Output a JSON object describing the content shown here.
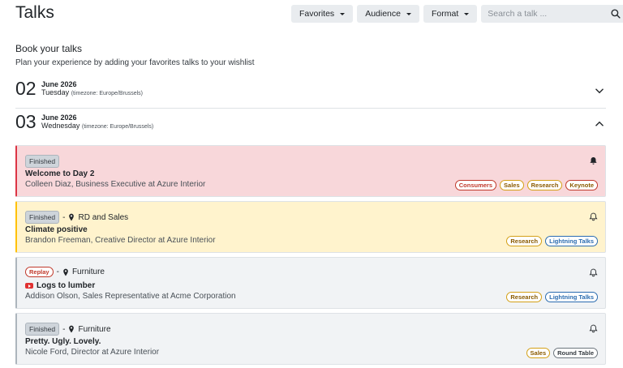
{
  "header": {
    "title": "Talks"
  },
  "toolbar": {
    "favorites_label": "Favorites",
    "audience_label": "Audience",
    "format_label": "Format",
    "search_placeholder": "Search a talk ..."
  },
  "intro": {
    "title": "Book your talks",
    "subtitle": "Plan your experience by adding your favorites talks to your wishlist"
  },
  "days": [
    {
      "num": "02",
      "month": "June 2026",
      "weekday": "Tuesday",
      "timezone": "(timezone: Europe/Brussels)",
      "chevron": "chevron-down-icon"
    },
    {
      "num": "03",
      "month": "June 2026",
      "weekday": "Wednesday",
      "timezone": "(timezone: Europe/Brussels)",
      "chevron": "chevron-up-icon"
    }
  ],
  "talks": [
    {
      "status": "Finished",
      "location": "",
      "title": "Welcome to Day 2",
      "speaker": "Colleen Diaz, Business Executive at Azure Interior",
      "bell": "bell-filled-icon",
      "accent": "#dc3545",
      "bg": "#f8d7da",
      "tags": [
        "Consumers",
        "Sales",
        "Research",
        "Keynote"
      ]
    },
    {
      "status": "Finished",
      "location": "RD and Sales",
      "title": "Climate positive",
      "speaker": "Brandon Freeman, Creative Director at Azure Interior",
      "bell": "bell-outline-icon",
      "accent": "#ffc107",
      "bg": "#fff3cd",
      "tags": [
        "Research",
        "Lightning Talks"
      ]
    },
    {
      "status": "Replay",
      "location": "Furniture",
      "title": "Logs to lumber",
      "speaker": "Addison Olson, Sales Representative at Acme Corporation",
      "bell": "bell-outline-icon",
      "accent": "#adb5bd",
      "bg": "#f1f3f5",
      "tags": [
        "Research",
        "Lightning Talks"
      ]
    },
    {
      "status": "Finished",
      "location": "Furniture",
      "title": "Pretty. Ugly. Lovely.",
      "speaker": "Nicole Ford, Director at Azure Interior",
      "bell": "bell-outline-icon",
      "accent": "#adb5bd",
      "bg": "#f1f3f5",
      "tags": [
        "Sales",
        "Round Table"
      ]
    }
  ],
  "colors": {
    "tag_red": "#c0392b",
    "tag_orange": "#b7791f",
    "tag_blue": "#2b6cb0",
    "tag_gray": "#495057"
  }
}
